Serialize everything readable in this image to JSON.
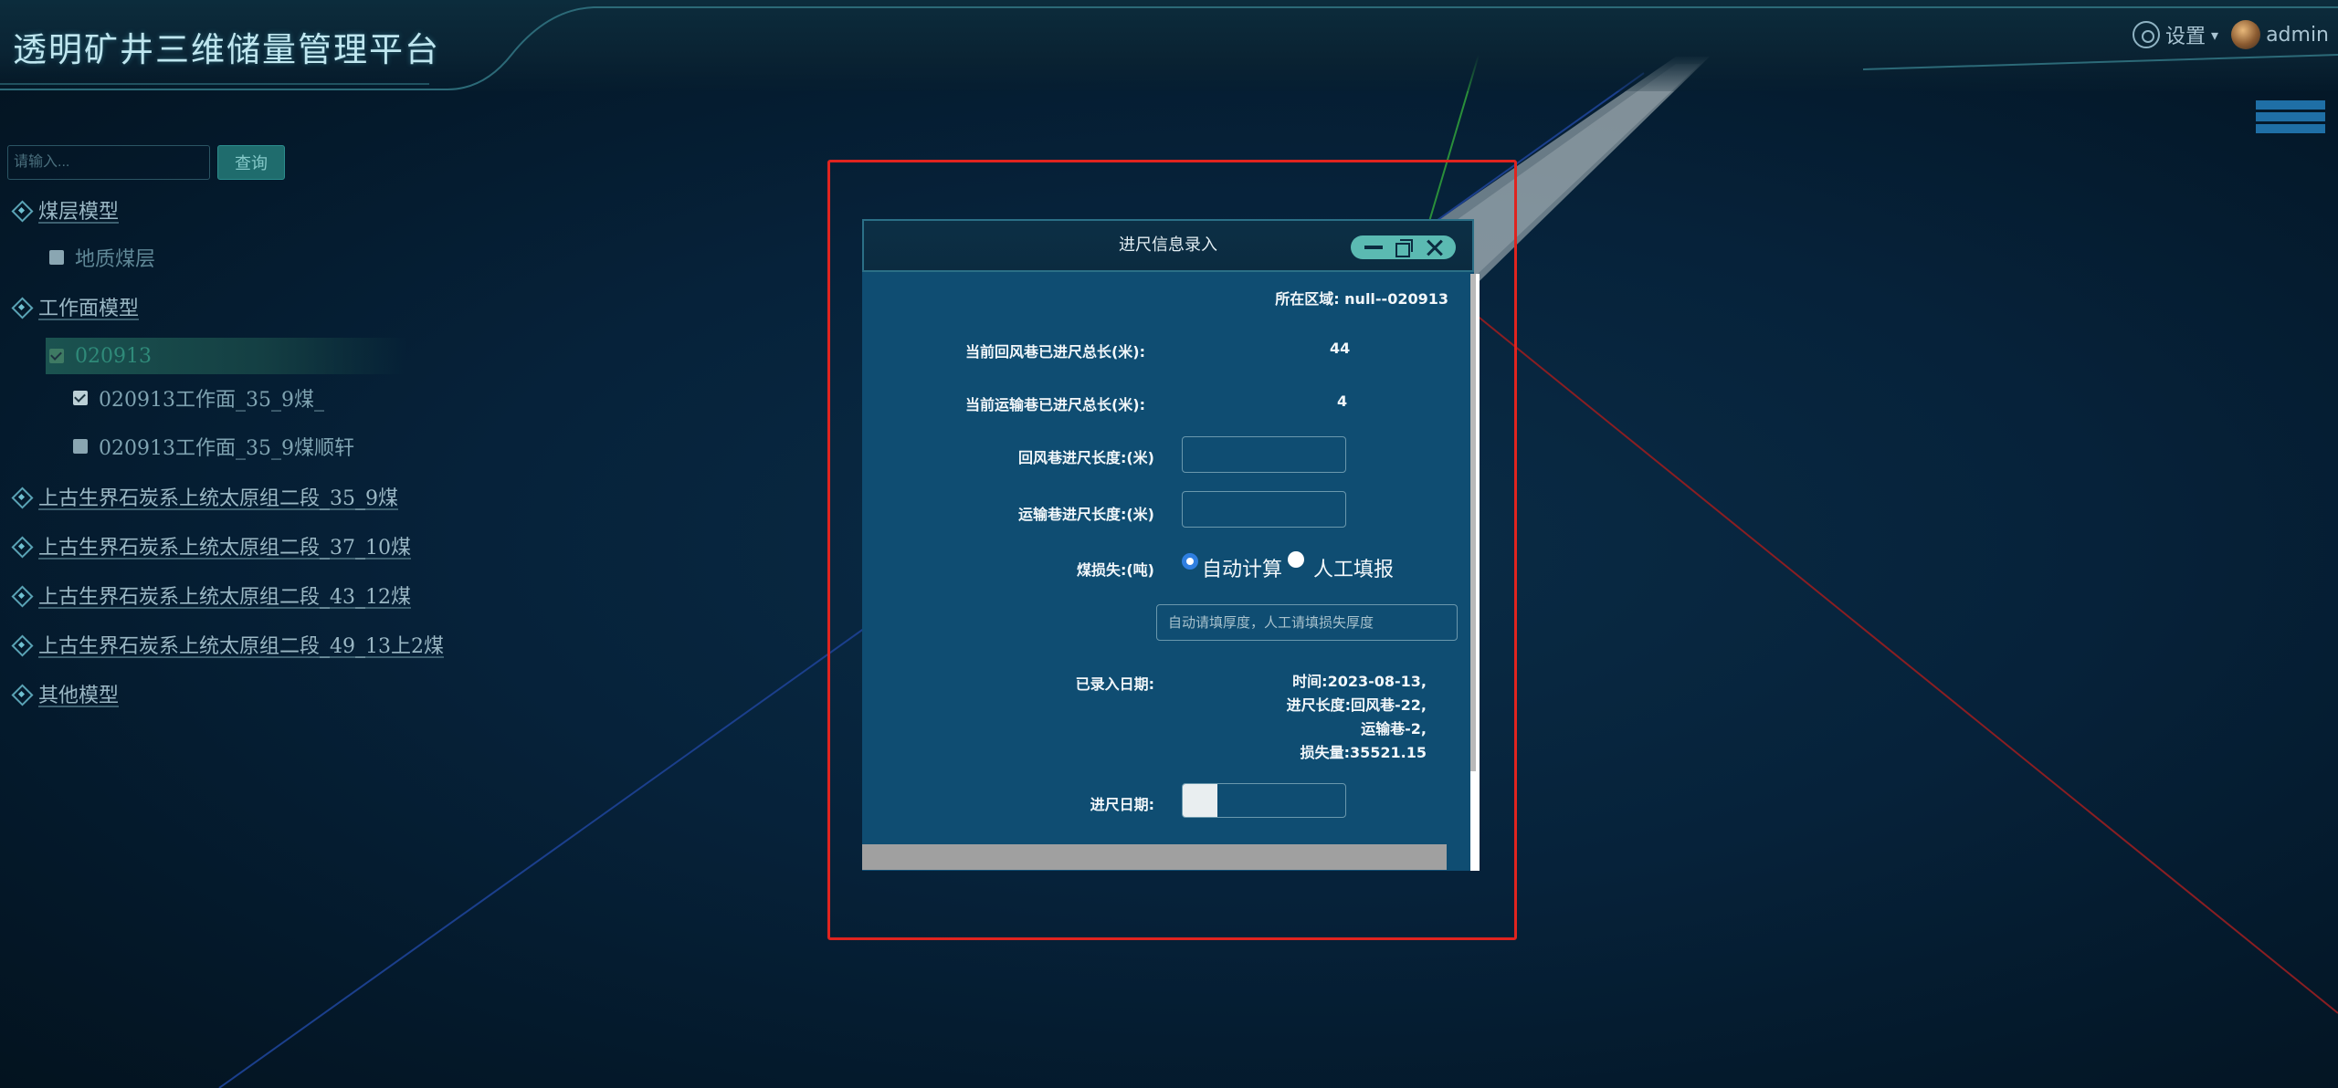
{
  "header": {
    "title": "透明矿井三维储量管理平台",
    "settings_label": "设置",
    "settings_caret": "▾",
    "user_name": "admin"
  },
  "search": {
    "placeholder": "请输入...",
    "button": "查询"
  },
  "tree": {
    "seam_model": "煤层模型",
    "geo_seam": "地质煤层",
    "face_model": "工作面模型",
    "face_020913": "020913",
    "face_child_1": "020913工作面_35_9煤_",
    "face_child_2": "020913工作面_35_9煤顺轩",
    "seam_35": "上古生界石炭系上统太原组二段_35_9煤",
    "seam_37": "上古生界石炭系上统太原组二段_37_10煤",
    "seam_43": "上古生界石炭系上统太原组二段_43_12煤",
    "seam_49": "上古生界石炭系上统太原组二段_49_13上2煤",
    "other_model": "其他模型"
  },
  "dialog": {
    "title": "进尺信息录入",
    "area_label": "所在区域: null--020913",
    "return_total_label": "当前回风巷已进尺总长(米):",
    "return_total_value": "44",
    "haul_total_label": "当前运输巷已进尺总长(米):",
    "haul_total_value": "4",
    "return_len_label": "回风巷进尺长度:(米)",
    "haul_len_label": "运输巷进尺长度:(米)",
    "loss_label": "煤损失:(吨)",
    "radio_auto": "自动计算",
    "radio_manual": "人工填报",
    "loss_placeholder": "自动请填厚度，人工请填损失厚度",
    "recorded_label": "已录入日期:",
    "history": [
      "时间:2023-08-13,",
      "进尺长度:回风巷-22,",
      "运输巷-2,",
      "损失量:35521.15"
    ],
    "date_label": "进尺日期:"
  }
}
